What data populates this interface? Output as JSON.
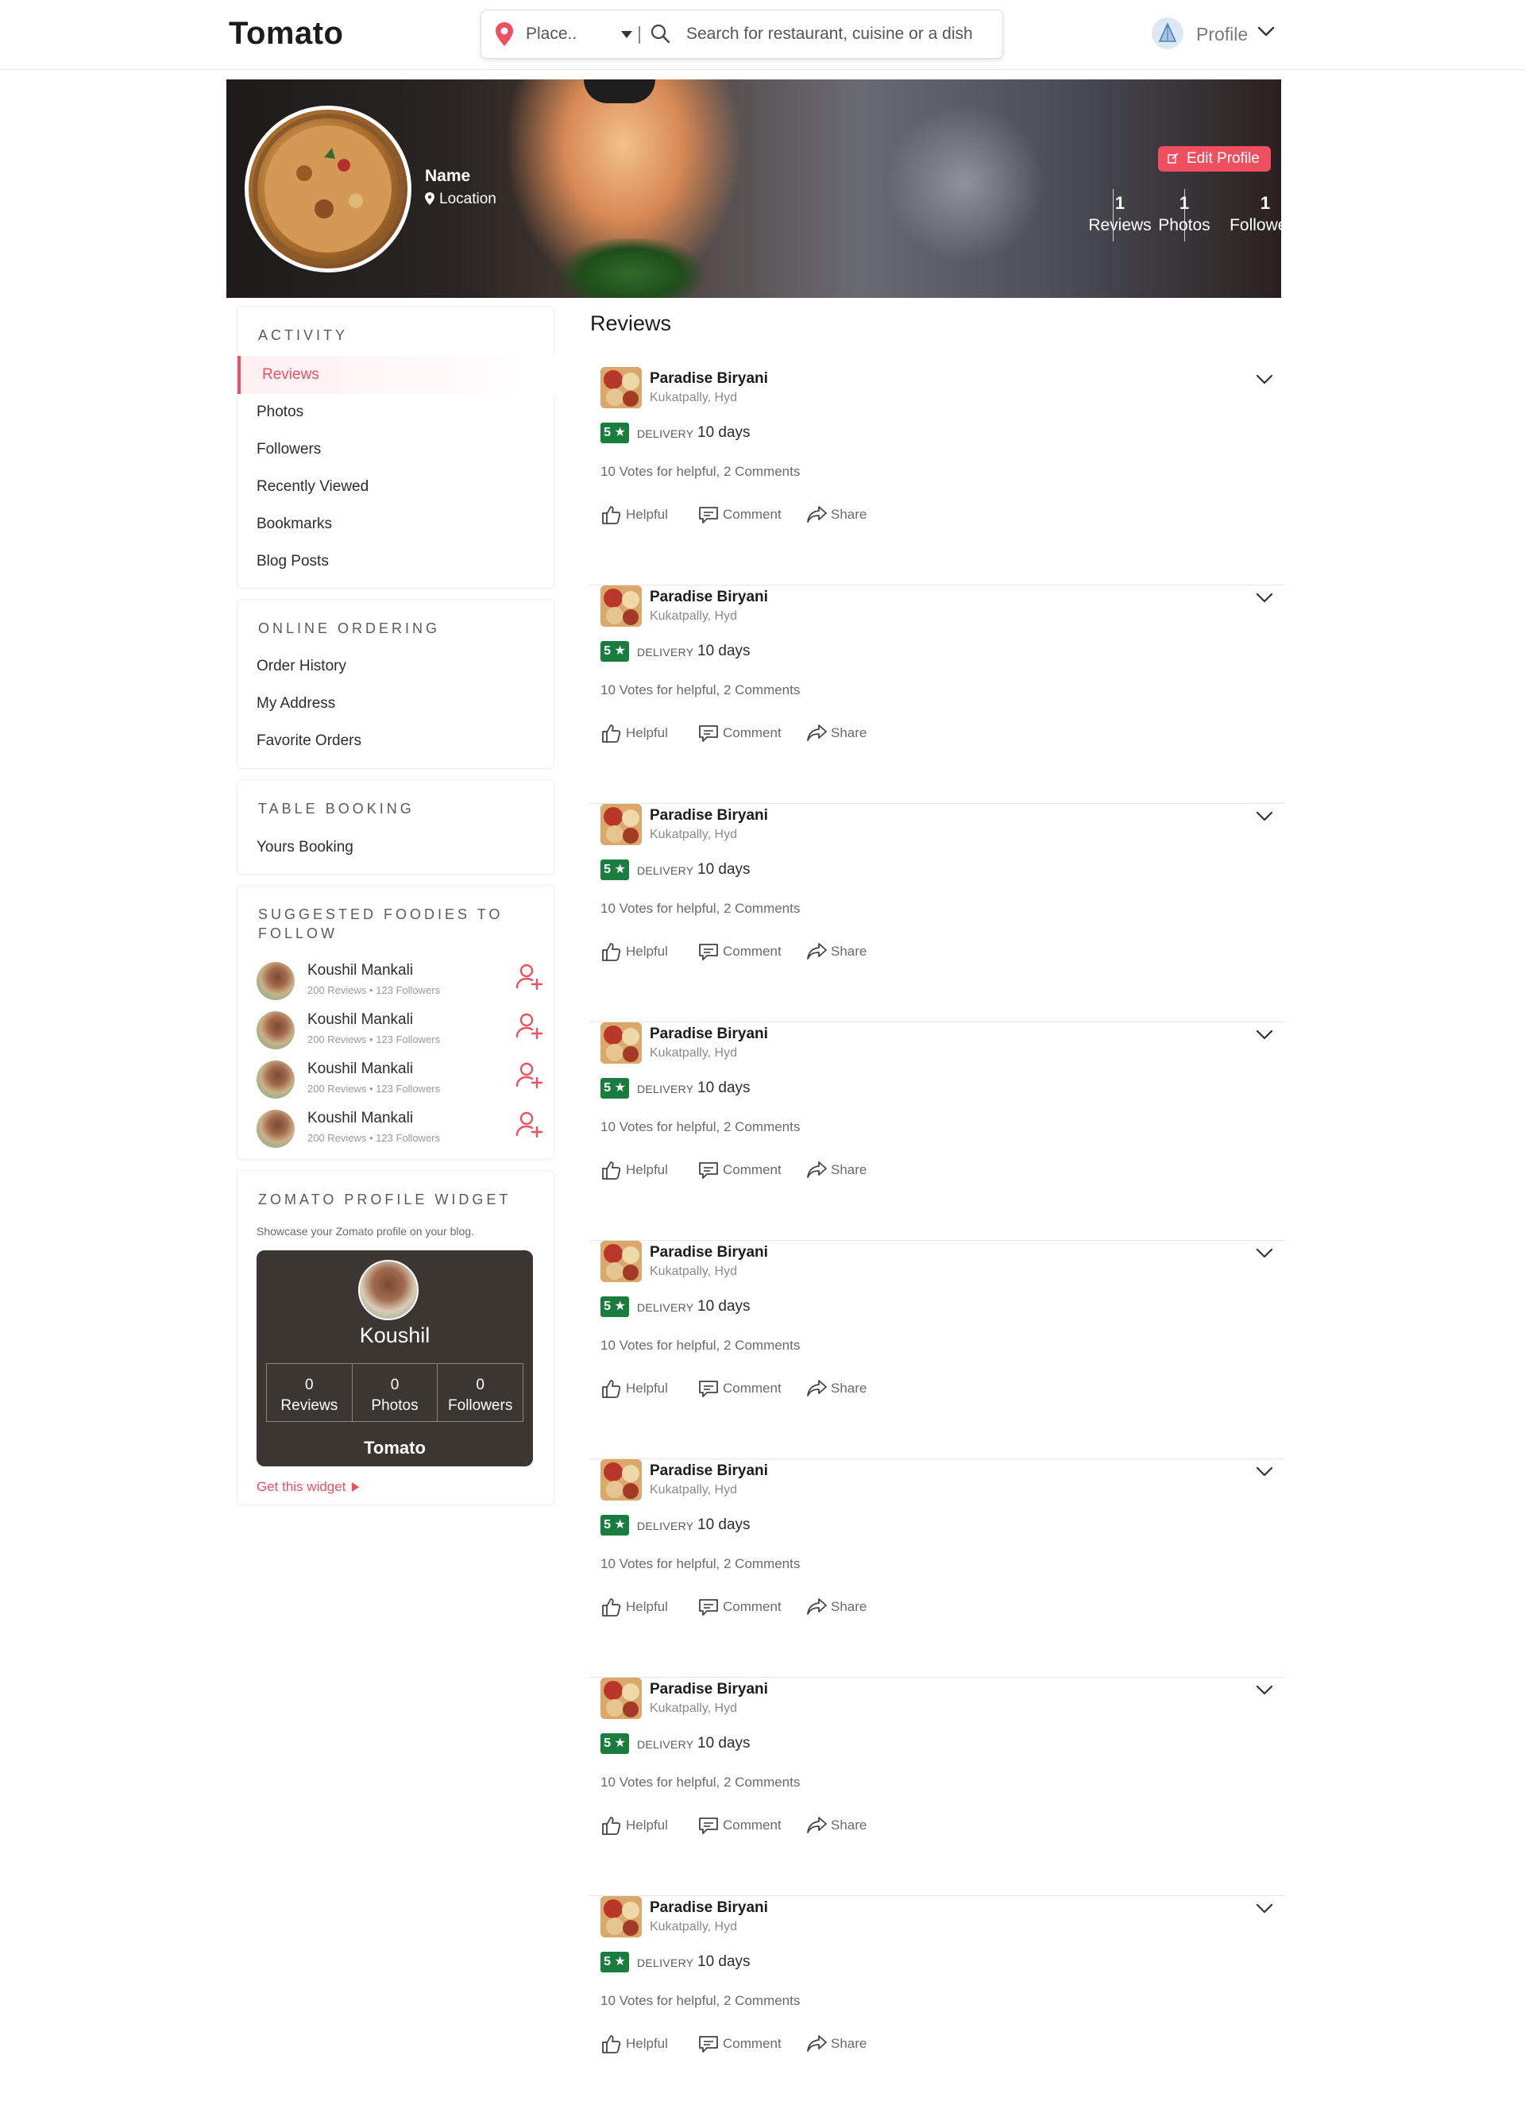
{
  "header": {
    "logo": "Tomato",
    "place_placeholder": "Place..",
    "search_placeholder": "Search for restaurant, cuisine or a dish",
    "profile_label": "Profile"
  },
  "hero": {
    "name": "Name",
    "location": "Location",
    "edit_label": "Edit Profile",
    "stats": [
      {
        "value": "1",
        "label": "Reviews"
      },
      {
        "value": "1",
        "label": "Photos"
      },
      {
        "value": "1",
        "label": "Followers"
      }
    ]
  },
  "sidebar": {
    "activity": {
      "title": "ACTIVITY",
      "items": [
        "Reviews",
        "Photos",
        "Followers",
        "Recently Viewed",
        "Bookmarks",
        "Blog Posts"
      ],
      "active": "Reviews"
    },
    "online_ordering": {
      "title": "ONLINE ORDERING",
      "items": [
        "Order History",
        "My Address",
        "Favorite Orders"
      ]
    },
    "table_booking": {
      "title": "TABLE BOOKING",
      "items": [
        "Yours Booking"
      ]
    },
    "suggested": {
      "title_line1": "SUGGESTED FOODIES TO",
      "title_line2": "FOLLOW",
      "foodies": [
        {
          "name": "Koushil Mankali",
          "meta": "200 Reviews  •  123 Followers"
        },
        {
          "name": "Koushil Mankali",
          "meta": "200 Reviews  •  123 Followers"
        },
        {
          "name": "Koushil Mankali",
          "meta": "200 Reviews  •  123 Followers"
        },
        {
          "name": "Koushil Mankali",
          "meta": "200 Reviews  •  123 Followers"
        }
      ]
    },
    "widget": {
      "title": "ZOMATO PROFILE WIDGET",
      "description": "Showcase your Zomato profile on your blog.",
      "name": "Koushil",
      "stats": [
        {
          "value": "0",
          "label": "Reviews"
        },
        {
          "value": "0",
          "label": "Photos"
        },
        {
          "value": "0",
          "label": "Followers"
        }
      ],
      "brand": "Tomato",
      "link": "Get this widget"
    }
  },
  "reviews": {
    "heading": "Reviews",
    "items": [
      {
        "title": "Paradise Biryani",
        "location": "Kukatpally, Hyd",
        "rating": "5 ★",
        "type": "DELIVERY",
        "time": "10 days",
        "votes": "10 Votes for helpful, 2 Comments"
      },
      {
        "title": "Paradise Biryani",
        "location": "Kukatpally, Hyd",
        "rating": "5 ★",
        "type": "DELIVERY",
        "time": "10 days",
        "votes": "10 Votes for helpful, 2 Comments"
      },
      {
        "title": "Paradise Biryani",
        "location": "Kukatpally, Hyd",
        "rating": "5 ★",
        "type": "DELIVERY",
        "time": "10 days",
        "votes": "10 Votes for helpful, 2 Comments"
      },
      {
        "title": "Paradise Biryani",
        "location": "Kukatpally, Hyd",
        "rating": "5 ★",
        "type": "DELIVERY",
        "time": "10 days",
        "votes": "10 Votes for helpful, 2 Comments"
      },
      {
        "title": "Paradise Biryani",
        "location": "Kukatpally, Hyd",
        "rating": "5 ★",
        "type": "DELIVERY",
        "time": "10 days",
        "votes": "10 Votes for helpful, 2 Comments"
      },
      {
        "title": "Paradise Biryani",
        "location": "Kukatpally, Hyd",
        "rating": "5 ★",
        "type": "DELIVERY",
        "time": "10 days",
        "votes": "10 Votes for helpful, 2 Comments"
      },
      {
        "title": "Paradise Biryani",
        "location": "Kukatpally, Hyd",
        "rating": "5 ★",
        "type": "DELIVERY",
        "time": "10 days",
        "votes": "10 Votes for helpful, 2 Comments"
      },
      {
        "title": "Paradise Biryani",
        "location": "Kukatpally, Hyd",
        "rating": "5 ★",
        "type": "DELIVERY",
        "time": "10 days",
        "votes": "10 Votes for helpful, 2 Comments"
      }
    ],
    "actions": {
      "helpful": "Helpful",
      "comment": "Comment",
      "share": "Share"
    }
  },
  "colors": {
    "accent": "#ef4f5f",
    "rating_green": "#1a7c3e",
    "widget_bg": "#3b3632"
  },
  "icons": {
    "place": "map-pin-icon",
    "search": "search-icon",
    "profile_chevron": "chevron-down-icon",
    "edit": "edit-icon",
    "follow": "add-user-icon",
    "helpful": "thumbs-up-icon",
    "comment": "comment-icon",
    "share": "share-icon"
  }
}
